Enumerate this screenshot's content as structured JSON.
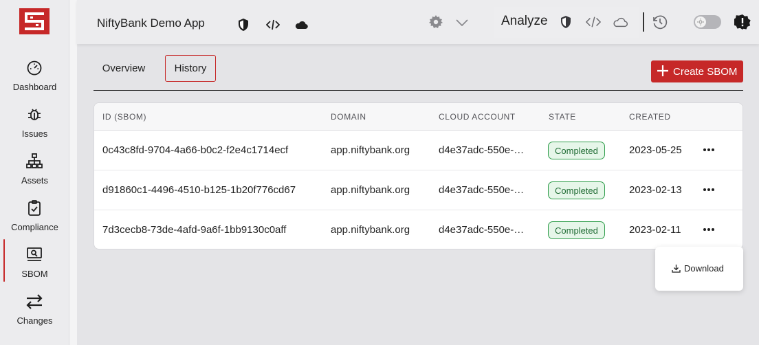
{
  "brand": {
    "accent": "#c62828",
    "success": "#2e9d4a"
  },
  "sidebar": {
    "items": [
      {
        "label": "Dashboard",
        "icon": "speedometer-icon"
      },
      {
        "label": "Issues",
        "icon": "bug-icon"
      },
      {
        "label": "Assets",
        "icon": "network-icon"
      },
      {
        "label": "Compliance",
        "icon": "clipboard-check-icon"
      },
      {
        "label": "SBOM",
        "icon": "monitor-search-icon",
        "active": true
      },
      {
        "label": "Changes",
        "icon": "arrows-exchange-icon"
      }
    ]
  },
  "header": {
    "app_title": "NiftyBank Demo App",
    "analyze_label": "Analyze"
  },
  "tabs": [
    {
      "label": "Overview"
    },
    {
      "label": "History",
      "active": true
    }
  ],
  "create_button": {
    "label": "Create SBOM"
  },
  "table": {
    "columns": [
      "ID (SBOM)",
      "DOMAIN",
      "CLOUD ACCOUNT",
      "STATE",
      "CREATED"
    ],
    "rows": [
      {
        "id": "0c43c8fd-9704-4a66-b0c2-f2e4c1714ecf",
        "domain": "app.niftybank.org",
        "cloud_account": "d4e37adc-550e-…",
        "state": "Completed",
        "created": "2023-05-25"
      },
      {
        "id": "d91860c1-4496-4510-b125-1b20f776cd67",
        "domain": "app.niftybank.org",
        "cloud_account": "d4e37adc-550e-…",
        "state": "Completed",
        "created": "2023-02-13"
      },
      {
        "id": "7d3cecb8-73de-4afd-9a6f-1bb9130c0aff",
        "domain": "app.niftybank.org",
        "cloud_account": "d4e37adc-550e-…",
        "state": "Completed",
        "created": "2023-02-11"
      }
    ]
  },
  "row_menu": {
    "download_label": "Download"
  }
}
